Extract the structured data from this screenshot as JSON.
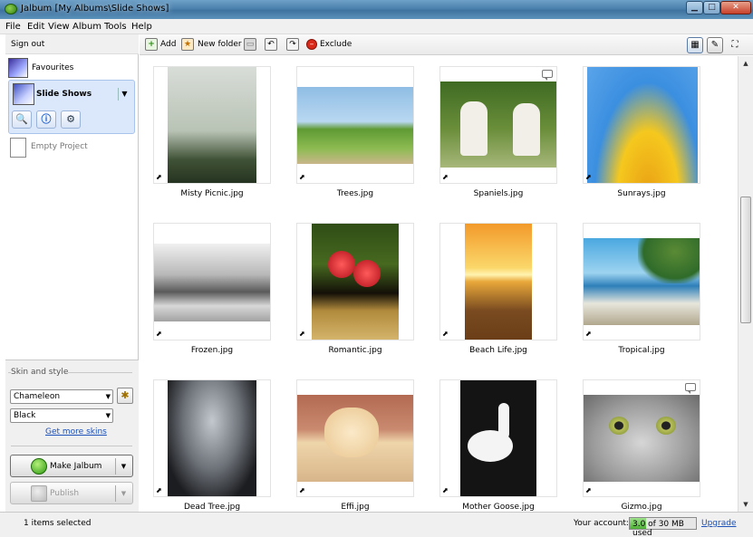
{
  "window": {
    "title": "Jalbum [My Albums\\Slide Shows]"
  },
  "menu": [
    "File",
    "Edit",
    "View",
    "Album",
    "Tools",
    "Help"
  ],
  "sidebar": {
    "sign_out": "Sign out",
    "projects": [
      {
        "label": "Favourites"
      },
      {
        "label": "Slide Shows"
      },
      {
        "label": "Empty Project"
      }
    ],
    "skin_section_label": "Skin and style",
    "skin_value": "Chameleon",
    "style_value": "Black",
    "more_skins_link": "Get more skins",
    "make_button": "Make Jalbum",
    "publish_button": "Publish"
  },
  "toolbar": {
    "add": "Add",
    "new_folder": "New folder",
    "exclude": "Exclude"
  },
  "images": [
    {
      "name": "Misty Picnic.jpg",
      "colors": [
        "#ccd3c8",
        "#5f6d55",
        "#2e3a26"
      ]
    },
    {
      "name": "Trees.jpg",
      "colors": [
        "#8fbde4",
        "#7bab47",
        "#4b7d2a"
      ]
    },
    {
      "name": "Spaniels.jpg",
      "colors": [
        "#5c7c36",
        "#f2efe8",
        "#5a2e1a"
      ]
    },
    {
      "name": "Sunrays.jpg",
      "colors": [
        "#3b8fe0",
        "#f5c81e",
        "#e89a10"
      ]
    },
    {
      "name": "Frozen.jpg",
      "colors": [
        "#e8e8e8",
        "#9a9a9a",
        "#3c3c3c"
      ]
    },
    {
      "name": "Romantic.jpg",
      "colors": [
        "#3a5a1e",
        "#d2202a",
        "#c8a858"
      ]
    },
    {
      "name": "Beach Life.jpg",
      "colors": [
        "#f2a63a",
        "#fde68a",
        "#7a4b20"
      ]
    },
    {
      "name": "Tropical.jpg",
      "colors": [
        "#3aa0d8",
        "#2f6b2a",
        "#f1f1e9"
      ]
    },
    {
      "name": "Dead Tree.jpg",
      "colors": [
        "#9aa0a8",
        "#3b3e44",
        "#121314"
      ]
    },
    {
      "name": "Effi.jpg",
      "colors": [
        "#b76b55",
        "#f4dcb4",
        "#d8b58a"
      ]
    },
    {
      "name": "Mother Goose.jpg",
      "colors": [
        "#141414",
        "#f4f4f4",
        "#e08a1e"
      ]
    },
    {
      "name": "Gizmo.jpg",
      "colors": [
        "#cfcfcf",
        "#8a8a8a",
        "#6fa040"
      ]
    }
  ],
  "status": {
    "selection": "1 items selected",
    "account_label": "Your account:",
    "usage_text": "3.0 of 30 MB used",
    "usage_fraction": 0.1,
    "upgrade_link": "Upgrade"
  }
}
